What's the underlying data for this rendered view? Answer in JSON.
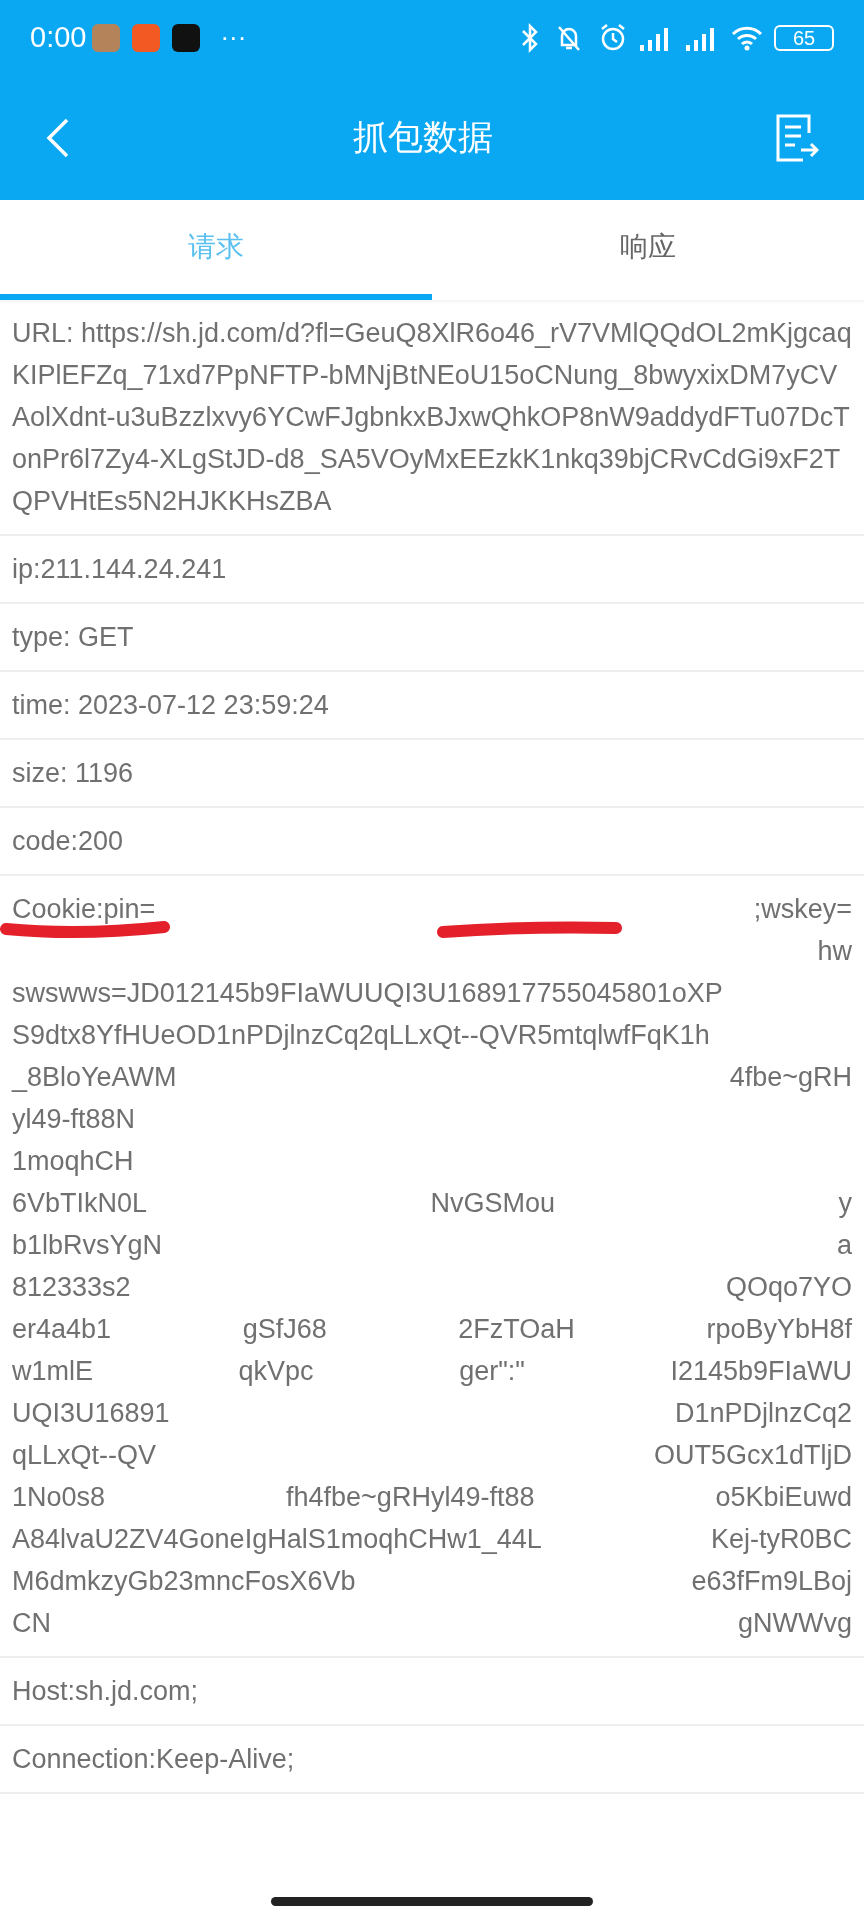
{
  "status_bar": {
    "time": "0:00",
    "more": "···",
    "battery": "65"
  },
  "app_bar": {
    "title": "抓包数据"
  },
  "tabs": [
    {
      "label": "请求",
      "selected": true
    },
    {
      "label": "响应",
      "selected": false
    }
  ],
  "fields": [
    {
      "kind": "text",
      "text": "URL: https://sh.jd.com/d?fl=GeuQ8XlR6o46_rV7VMlQQdOL2mKjgcaqKIPlEFZq_71xd7PpNFTP-bMNjBtNEoU15oCNung_8bwyxixDM7yCVAolXdnt-u3uBzzlxvy6YCwFJgbnkxBJxwQhkOP8nW9addydFTu07DcTonPr6l7Zy4-XLgStJD-d8_SA5VOyMxEEzkK1nkq39bjCRvCdGi9xF2TQPVHtEs5N2HJKKHsZBA"
    },
    {
      "kind": "text",
      "text": "ip:211.144.24.241"
    },
    {
      "kind": "text",
      "text": "type: GET"
    },
    {
      "kind": "text",
      "text": "time: 2023-07-12 23:59:24"
    },
    {
      "kind": "text",
      "text": "size: 1196"
    },
    {
      "kind": "text",
      "text": "code:200"
    },
    {
      "kind": "redacted",
      "lines": [
        [
          "Cookie:pin=",
          ";wskey="
        ],
        {
          "right_aligned": true,
          "parts": [
            "hw"
          ]
        },
        [
          "swswws=JD012145b9FIaWUUQI3U168917755045801oXP"
        ],
        [
          "S9dtx8YfHUeOD1nPDjlnzCq2qLLxQt--QVR5mtqlwfFqK1h"
        ],
        [
          "_8BloYeAWM",
          "4fbe~gRH"
        ],
        [
          "yl49-ft88N"
        ],
        [
          "1moqhCH"
        ],
        [
          "6VbTIkN0L",
          "NvGSMou",
          "y"
        ],
        [
          "b1lbRvsYgN",
          "a"
        ],
        [
          "812333s2",
          "QOqo7YO"
        ],
        [
          "er4a4b1",
          "gSfJ68",
          "2FzTOaH",
          "rpoByYbH8f"
        ],
        [
          "w1mlE",
          "qkVpc",
          "ger\":\"",
          "I2145b9FIaWU"
        ],
        [
          "UQI3U16891",
          "D1nPDjlnzCq2"
        ],
        [
          "qLLxQt--QV",
          "OUT5Gcx1dTljD"
        ],
        [
          "1No0s8",
          "fh4fbe~gRHyl49-ft88",
          "o5KbiEuwd"
        ],
        [
          "A84lvaU2ZV4GoneIgHalS1moqhCHw1_44L",
          "Kej-tyR0BC"
        ],
        [
          "M6dmkzyGb23mncFosX6Vb",
          "e63fFm9LBoj"
        ],
        [
          "CN",
          "gNWWvg"
        ]
      ]
    },
    {
      "kind": "text",
      "text": "Host:sh.jd.com;"
    },
    {
      "kind": "text",
      "text": "Connection:Keep-Alive;"
    }
  ]
}
